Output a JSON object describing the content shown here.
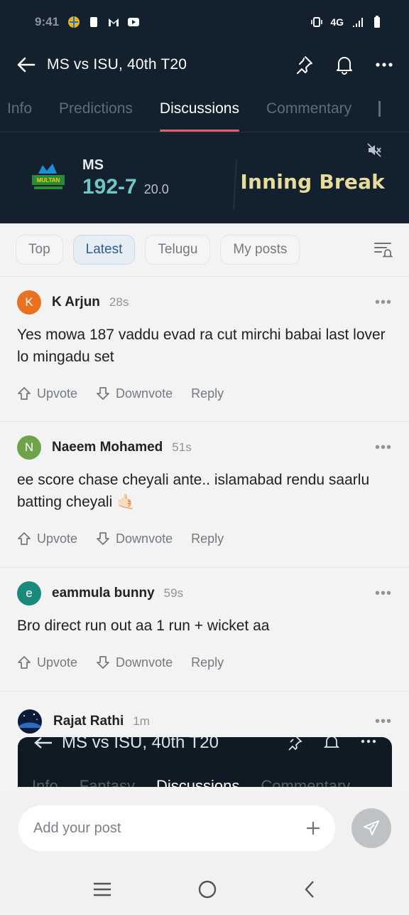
{
  "status_bar": {
    "time": "9:41",
    "network": "4G"
  },
  "header": {
    "title": "MS vs ISU, 40th T20"
  },
  "tabs": [
    {
      "label": "Info",
      "active": false
    },
    {
      "label": "Predictions",
      "active": false
    },
    {
      "label": "Discussions",
      "active": true
    },
    {
      "label": "Commentary",
      "active": false
    }
  ],
  "scorecard": {
    "logo_text": "MULTAN",
    "team": "MS",
    "score": "192-7",
    "overs": "20.0",
    "status": "Inning Break",
    "colors": {
      "score": "#6ec8c2",
      "status": "#e8dc9c",
      "bg": "#13202e"
    }
  },
  "filters": [
    {
      "label": "Top",
      "active": false
    },
    {
      "label": "Latest",
      "active": true
    },
    {
      "label": "Telugu",
      "active": false
    },
    {
      "label": "My posts",
      "active": false
    }
  ],
  "posts": [
    {
      "initial": "K",
      "avatar_color": "#e8721f",
      "author": "K Arjun",
      "time": "28s",
      "content": "Yes mowa 187  vaddu evad ra cut mirchi babai last lover lo mingadu set"
    },
    {
      "initial": "N",
      "avatar_color": "#6ea34c",
      "author": "Naeem Mohamed",
      "time": "51s",
      "content": "ee score chase cheyali ante.. islamabad rendu saarlu batting cheyali 🤙🏻"
    },
    {
      "initial": "e",
      "avatar_color": "#1a8a7d",
      "author": "eammula bunny",
      "time": "59s",
      "content": "Bro direct run out aa 1 run + wicket aa"
    },
    {
      "initial": "",
      "avatar_color": "#0c1b3a",
      "author": "Rajat Rathi",
      "time": "1m",
      "content": ""
    }
  ],
  "post_actions": {
    "upvote": "Upvote",
    "downvote": "Downvote",
    "reply": "Reply"
  },
  "overlay": {
    "title": "MS vs ISU, 40th T20",
    "tabs": [
      "Info",
      "Fantasy",
      "Discussions",
      "Commentary"
    ]
  },
  "composer": {
    "placeholder": "Add your post"
  }
}
